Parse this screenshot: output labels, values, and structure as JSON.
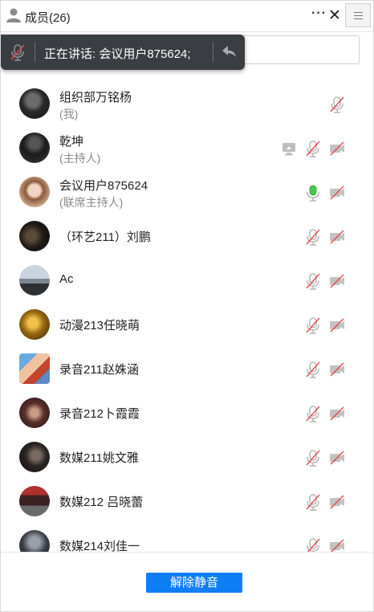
{
  "header": {
    "title": "成员(26)",
    "more_label": "···",
    "close_label": "✕"
  },
  "speaker_bar": {
    "text": "正在讲话: 会议用户875624;"
  },
  "members": [
    {
      "name": "组织部万铭杨",
      "role": "(我)",
      "avatar": "dark",
      "icons": [
        "mic-muted-icon"
      ]
    },
    {
      "name": "乾坤",
      "role": "(主持人)",
      "avatar": "dark2",
      "icons": [
        "screen-share-icon",
        "mic-muted-icon",
        "camera-off-icon"
      ]
    },
    {
      "name": "会议用户875624",
      "role": "(联席主持人)",
      "avatar": "girl",
      "icons": [
        "mic-active-icon",
        "camera-off-icon"
      ]
    },
    {
      "name": "（环艺211）刘鹏",
      "role": "",
      "avatar": "dark3",
      "icons": [
        "mic-muted-icon",
        "camera-off-icon"
      ]
    },
    {
      "name": "Ac",
      "role": "",
      "avatar": "street",
      "icons": [
        "mic-muted-icon",
        "camera-off-icon"
      ]
    },
    {
      "name": "动漫213任晓萌",
      "role": "",
      "avatar": "gold",
      "icons": [
        "mic-muted-icon",
        "camera-off-icon"
      ]
    },
    {
      "name": "录音211赵姝涵",
      "role": "",
      "avatar": "colorful",
      "icons": [
        "mic-muted-icon",
        "camera-off-icon"
      ]
    },
    {
      "name": "录音212卜霞霞",
      "role": "",
      "avatar": "crowd",
      "icons": [
        "mic-muted-icon",
        "camera-off-icon"
      ]
    },
    {
      "name": "数媒211姚文雅",
      "role": "",
      "avatar": "dark4",
      "icons": [
        "mic-muted-icon",
        "camera-off-icon"
      ]
    },
    {
      "name": "数媒212 吕晓蕾",
      "role": "",
      "avatar": "red",
      "icons": [
        "mic-muted-icon",
        "camera-off-icon"
      ]
    },
    {
      "name": "数媒214刘佳一",
      "role": "",
      "avatar": "dark5",
      "icons": [
        "mic-muted-icon",
        "camera-off-icon"
      ]
    }
  ],
  "footer": {
    "unmute_button": "解除静音"
  },
  "colors": {
    "accent": "#0f7ef5",
    "muted_icon": "#b9b9b9",
    "muted_slash": "#e24a4a",
    "active_mic": "#46c94a",
    "speaker_bar_bg": "#3a3d42"
  }
}
